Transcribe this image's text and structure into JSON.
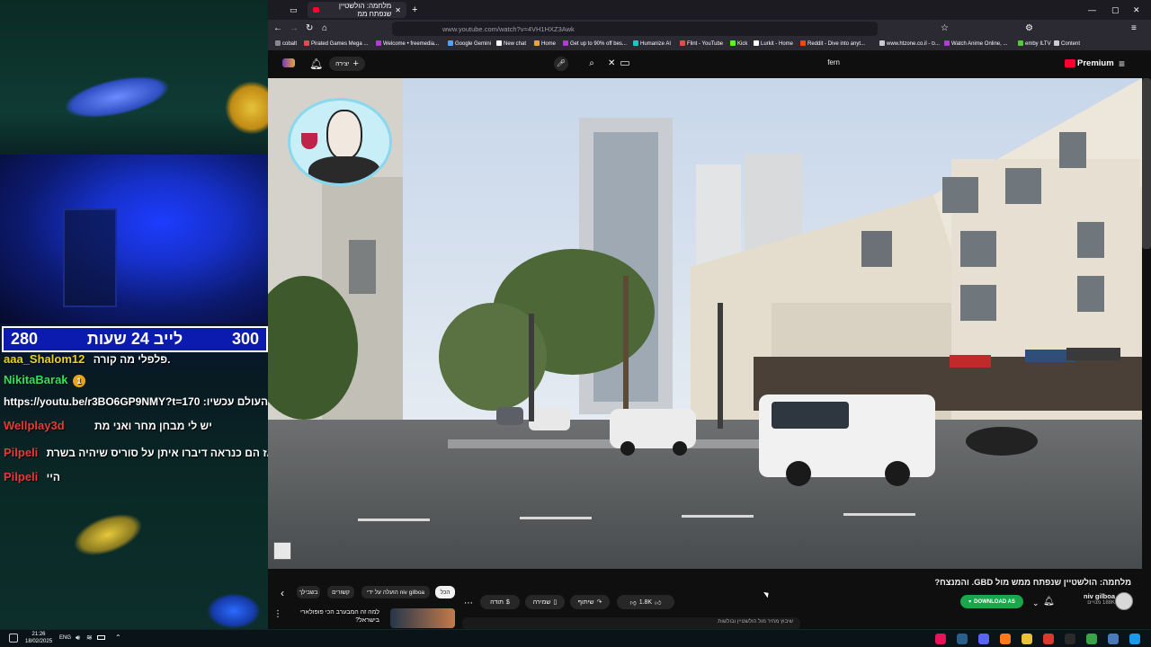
{
  "stream": {
    "scoreboard": {
      "left_number": "280",
      "title": "לייב 24 שעות",
      "right_number": "300"
    },
    "chat": [
      {
        "user": "aaa_Shalom12",
        "message": "פלפלי מה קורה.",
        "user_color": "#e6d31a"
      },
      {
        "user": "NikitaBarak",
        "badge": "1",
        "message": "",
        "user_color": "#35e05a"
      },
      {
        "user": "",
        "message": "https://youtu.be/r3BO6GP9NMY?t=170 :העולם עכשיו",
        "user_color": "#ffffff"
      },
      {
        "user": "Wellplay3d",
        "message": "יש לי מבחן מחר ואני מת",
        "user_color": "#e83a3a"
      },
      {
        "user": "Pilpeli",
        "message": "אז הם כנראה דיברו איתן על סוריס שיהיה בשרת",
        "user_color": "#e83a3a"
      },
      {
        "user": "Pilpeli",
        "message": "היי",
        "user_color": "#e83a3a"
      }
    ]
  },
  "browser": {
    "tab_title": "מלחמה: הולשטיין שנפתח ממ",
    "url": "www.youtube.com/watch?v=4VH1HXZ3Awk",
    "bookmarks": [
      {
        "label": "cobalt",
        "color": "#888888"
      },
      {
        "label": "Pirated Games Mega ...",
        "color": "#e44b4b"
      },
      {
        "label": "Welcome • freemedia...",
        "color": "#b33ad8"
      },
      {
        "label": "Google Gemini",
        "color": "#4aa3ff"
      },
      {
        "label": "New chat",
        "color": "#ffffff"
      },
      {
        "label": "Home",
        "color": "#e8a33b"
      },
      {
        "label": "Get up to 90% off bes...",
        "color": "#b33ad8"
      },
      {
        "label": "Humanize AI",
        "color": "#1ac7c2"
      },
      {
        "label": "Flint - YouTube",
        "color": "#e44b4b"
      },
      {
        "label": "Kick",
        "color": "#53fc18"
      },
      {
        "label": "Lurkit - Home",
        "color": "#ffffff"
      },
      {
        "label": "Reddit - Dive into anyt...",
        "color": "#ff4500"
      },
      {
        "label": "www.htzone.co.il - ס...",
        "color": "#cccccc"
      },
      {
        "label": "Watch Anime Online, ...",
        "color": "#b33ad8"
      },
      {
        "label": "emby ILTV",
        "color": "#53c83b"
      },
      {
        "label": "Content",
        "color": "#cccccc"
      }
    ]
  },
  "youtube": {
    "create_label": "יצירה",
    "search_value": "fern",
    "premium_label": "Premium",
    "video_title": "מלחמה: הולשטיין שנפתח ממש מול GBD. והמנצח?",
    "channel_name": "niv gilboa",
    "subscribers": "188K מנויים",
    "download_label": "DOWNLOAD AS",
    "likes": "1.8K",
    "share_label": "שיתוף",
    "save_label": "שמירה",
    "thanks_label": "תודה",
    "chips": [
      "הכל",
      "הועלה על ידי niv gilboa",
      "קשורים",
      "בשבילך"
    ],
    "recommended_title": "למה זה המבערב הכי פופולארי בישראל?",
    "comment_preview": "שיבוץ מחיר מול הולשטיין ובולשות"
  },
  "taskbar": {
    "time": "21:26",
    "date": "18/02/2025",
    "lang": "ENG"
  }
}
